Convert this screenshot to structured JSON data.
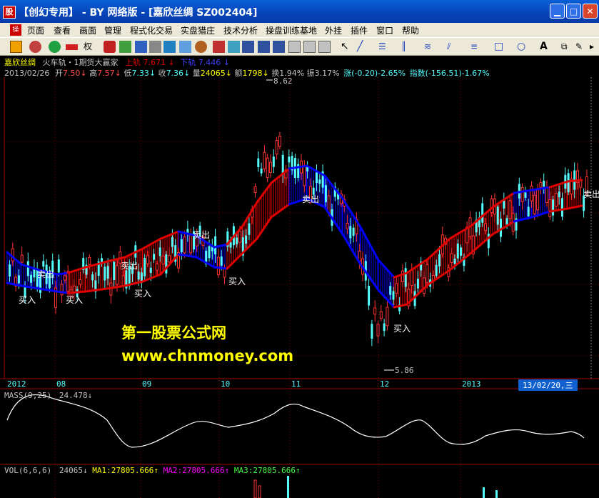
{
  "window": {
    "app_icon": "stock-app-icon",
    "title": "【创幻专用】 - BY 网络版 - [嘉欣丝绸 SZ002404]",
    "buttons": [
      "minimize-icon",
      "maximize-icon",
      "close-icon"
    ]
  },
  "menu": {
    "items": [
      "页面",
      "查看",
      "画面",
      "管理",
      "程式化交易",
      "实盘猎庄",
      "技术分析",
      "操盘训练基地",
      "外挂",
      "插件",
      "窗口",
      "帮助"
    ]
  },
  "toolbar": {
    "quan_label": "权",
    "text_tool": "A"
  },
  "stock_header": {
    "name": "嘉欣丝绸",
    "indicator": "火车轨・1期货大赢家",
    "upper_label": "上轨",
    "upper_value": "7.671",
    "lower_label": "下轨",
    "lower_value": "7.446"
  },
  "quote": {
    "date": "2013/02/26",
    "open_label": "开",
    "open_value": "7.50",
    "high_label": "高",
    "high_value": "7.57",
    "low_label": "低",
    "low_value": "7.33",
    "close_label": "收",
    "close_value": "7.36",
    "volume_label": "量",
    "volume_value": "24065",
    "amount_label": "额",
    "amount_value": "1798",
    "turnover_label": "换",
    "turnover_value": "1.94%",
    "amplitude_label": "振",
    "amplitude_value": "3.17%",
    "change_label": "涨",
    "change_value": "(-0.20)-2.65%",
    "index_label": "指数",
    "index_value": "(-156.51)-1.67%"
  },
  "price_annotations": {
    "high": "8.62",
    "low": "5.86"
  },
  "signals": {
    "buy_label": "买入",
    "sell_label": "卖出"
  },
  "watermark": {
    "line1": "第一股票公式网",
    "line2": "www.chnmoney.com"
  },
  "time_axis": {
    "labels": [
      "2012",
      "08",
      "09",
      "10",
      "11",
      "12",
      "2013"
    ],
    "cursor_label": "13/02/20,三"
  },
  "mass": {
    "label": "MASS(9,25)",
    "value": "24.478",
    "arrow": "↓"
  },
  "volume_panel": {
    "label": "VOL(6,6,6)",
    "value": "24065",
    "arrow": "↓",
    "ma1": "MA1:27805.666",
    "ma2": "MA2:27805.666",
    "ma3": "MA3:27805.666",
    "up_arrow": "↑"
  },
  "colors": {
    "up_candle": "#ff3232",
    "down_candle": "#54fcfc",
    "upper_band_up": "#e00000",
    "band_down": "#0000ff",
    "signal_text": "#ffffff",
    "watermark": "#ffff00",
    "mass_line": "#ffffff",
    "grid": "#800000"
  }
}
